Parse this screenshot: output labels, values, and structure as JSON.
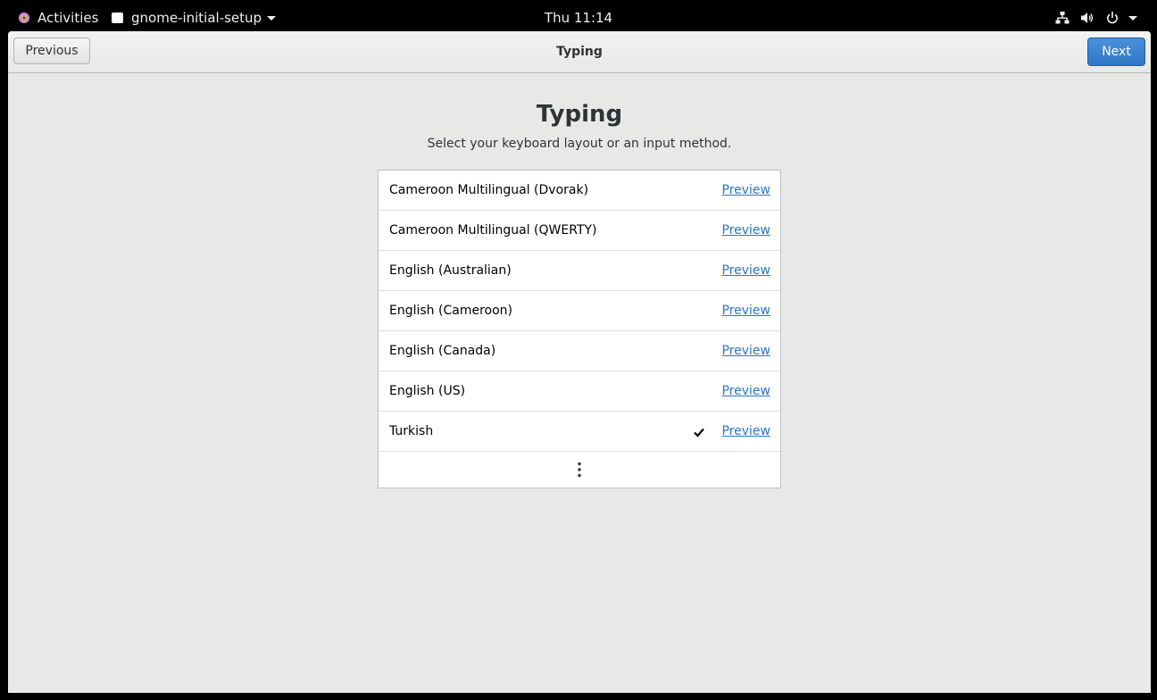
{
  "topbar": {
    "activities_label": "Activities",
    "app_menu_label": "gnome-initial-setup",
    "clock": "Thu 11:14"
  },
  "headerbar": {
    "title": "Typing",
    "previous_label": "Previous",
    "next_label": "Next"
  },
  "page": {
    "title": "Typing",
    "subtitle": "Select your keyboard layout or an input method."
  },
  "layouts": [
    {
      "name": "Cameroon Multilingual (Dvorak)",
      "preview": "Preview",
      "selected": false
    },
    {
      "name": "Cameroon Multilingual (QWERTY)",
      "preview": "Preview",
      "selected": false
    },
    {
      "name": "English (Australian)",
      "preview": "Preview",
      "selected": false
    },
    {
      "name": "English (Cameroon)",
      "preview": "Preview",
      "selected": false
    },
    {
      "name": "English (Canada)",
      "preview": "Preview",
      "selected": false
    },
    {
      "name": "English (US)",
      "preview": "Preview",
      "selected": false
    },
    {
      "name": "Turkish",
      "preview": "Preview",
      "selected": true
    }
  ],
  "icons": {
    "activities": "gnome-foot-icon",
    "app": "app-window-icon",
    "network": "network-wired-icon",
    "volume": "volume-icon",
    "power": "power-icon",
    "check": "checkmark-icon",
    "more": "view-more-icon"
  },
  "colors": {
    "accent": "#3077c7",
    "link": "#2a76c6",
    "window_bg": "#e8e8e7"
  }
}
